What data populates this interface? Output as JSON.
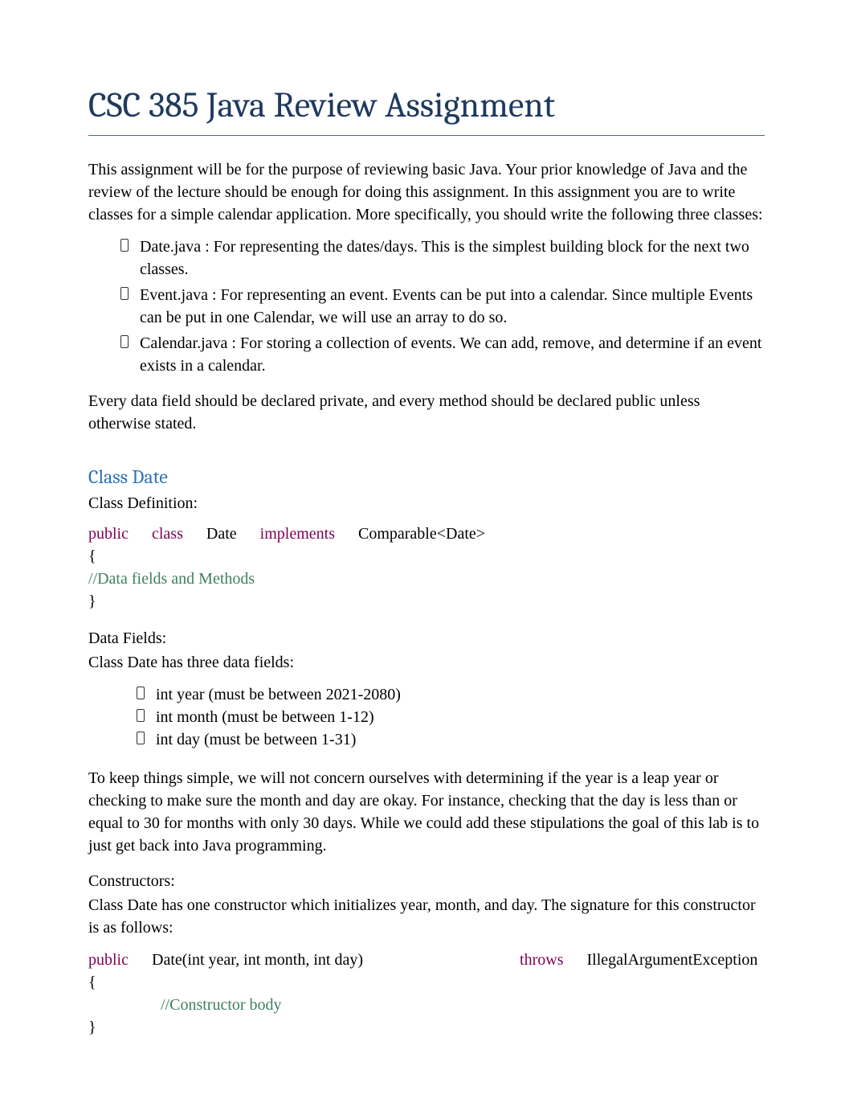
{
  "title": "CSC 385 Java Review Assignment",
  "intro": "This assignment will be for the purpose of reviewing basic Java.  Your prior knowledge of Java and the review of the lecture should be enough for doing this assignment.     In this assignment you are to write classes for a simple calendar  application.  More specifically, you should write the following three classes:",
  "class_list": [
    "Date.java : For representing the dates/days.     This is the simplest building block for the next two classes.",
    "Event.java : For representing an event.   Events can be put into a calendar.   Since multiple Events can be put in one Calendar, we will use an array to do so.",
    "Calendar.java : For storing a collection of events.   We can add, remove, and determine if an event exists in a calendar."
  ],
  "every_field": "Every data field should be declared private, and every method should be declared public unless otherwise stated.",
  "section_heading": "Class Date",
  "class_def_label": "Class Definition:",
  "code1": {
    "kw_public": "public",
    "kw_class": "class",
    "name": "Date",
    "kw_implements": "implements",
    "iface": "Comparable<Date>",
    "brace_open": "{",
    "comment": "//Data fields and Methods",
    "brace_close": "}"
  },
  "data_fields_label": "Data Fields:",
  "data_fields_intro": "Class Date has three data fields:",
  "fields": [
    "int year  (must be between 2021-2080)",
    "int month  (must be between 1-12)",
    "int day  (must be between 1-31)"
  ],
  "simple_note": "To keep things simple, we will not concern ourselves with determining if the year is a leap year or checking to make sure the month and day are okay.    For instance, checking that the day is less than or equal to 30 for months with only 30 days.   While we could add these stipulations the goal of this lab is to just get back into Java programming.",
  "constructors_label": "Constructors:",
  "constructors_intro": "Class Date has one constructor which initializes year, month, and day.   The signature for this constructor is as follows:",
  "code2": {
    "kw_public": "public",
    "sig": "Date(int year, int month, int day)",
    "kw_throws": "throws",
    "ex": "IllegalArgumentException",
    "brace_open": "{",
    "comment": "//Constructor body",
    "brace_close": "}"
  }
}
